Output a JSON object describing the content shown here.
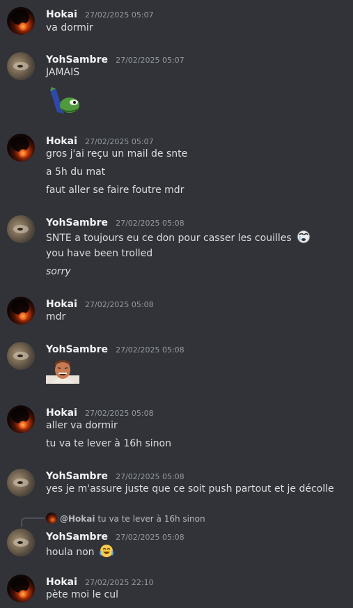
{
  "messages": [
    {
      "author": "Hokai",
      "timestamp": "27/02/2025 05:07",
      "lines": [
        "va dormir"
      ]
    },
    {
      "author": "YohSambre",
      "timestamp": "27/02/2025 05:07",
      "lines": [
        "JAMAIS"
      ],
      "sticker": "pepe-dab-sticker"
    },
    {
      "author": "Hokai",
      "timestamp": "27/02/2025 05:07",
      "lines": [
        "gros j'ai reçu un mail de snte",
        "a 5h du mat",
        "faut aller se faire foutre mdr"
      ]
    },
    {
      "author": "YohSambre",
      "timestamp": "27/02/2025 05:08",
      "lines": [
        "SNTE a toujours eu ce don pour casser les couilles",
        "you have been trolled",
        "sorry"
      ],
      "inline_emoji": "crying-face-emoji"
    },
    {
      "author": "Hokai",
      "timestamp": "27/02/2025 05:08",
      "lines": [
        "mdr"
      ]
    },
    {
      "author": "YohSambre",
      "timestamp": "27/02/2025 05:08",
      "lines": [],
      "sticker": "laughing-man-sticker"
    },
    {
      "author": "Hokai",
      "timestamp": "27/02/2025 05:08",
      "lines": [
        "aller va dormir",
        "tu va te lever à 16h sinon"
      ]
    },
    {
      "author": "YohSambre",
      "timestamp": "27/02/2025 05:08",
      "lines": [
        "yes je m'assure juste que ce soit push partout et je décolle"
      ]
    },
    {
      "author": "YohSambre",
      "timestamp": "27/02/2025 05:08",
      "reply": {
        "mention": "@Hokai",
        "text": "tu va te lever à 16h sinon"
      },
      "lines": [
        "houla non"
      ],
      "inline_emoji": "joy-emoji"
    },
    {
      "author": "Hokai",
      "timestamp": "27/02/2025 22:10",
      "lines": [
        "pète moi le cul"
      ]
    }
  ]
}
